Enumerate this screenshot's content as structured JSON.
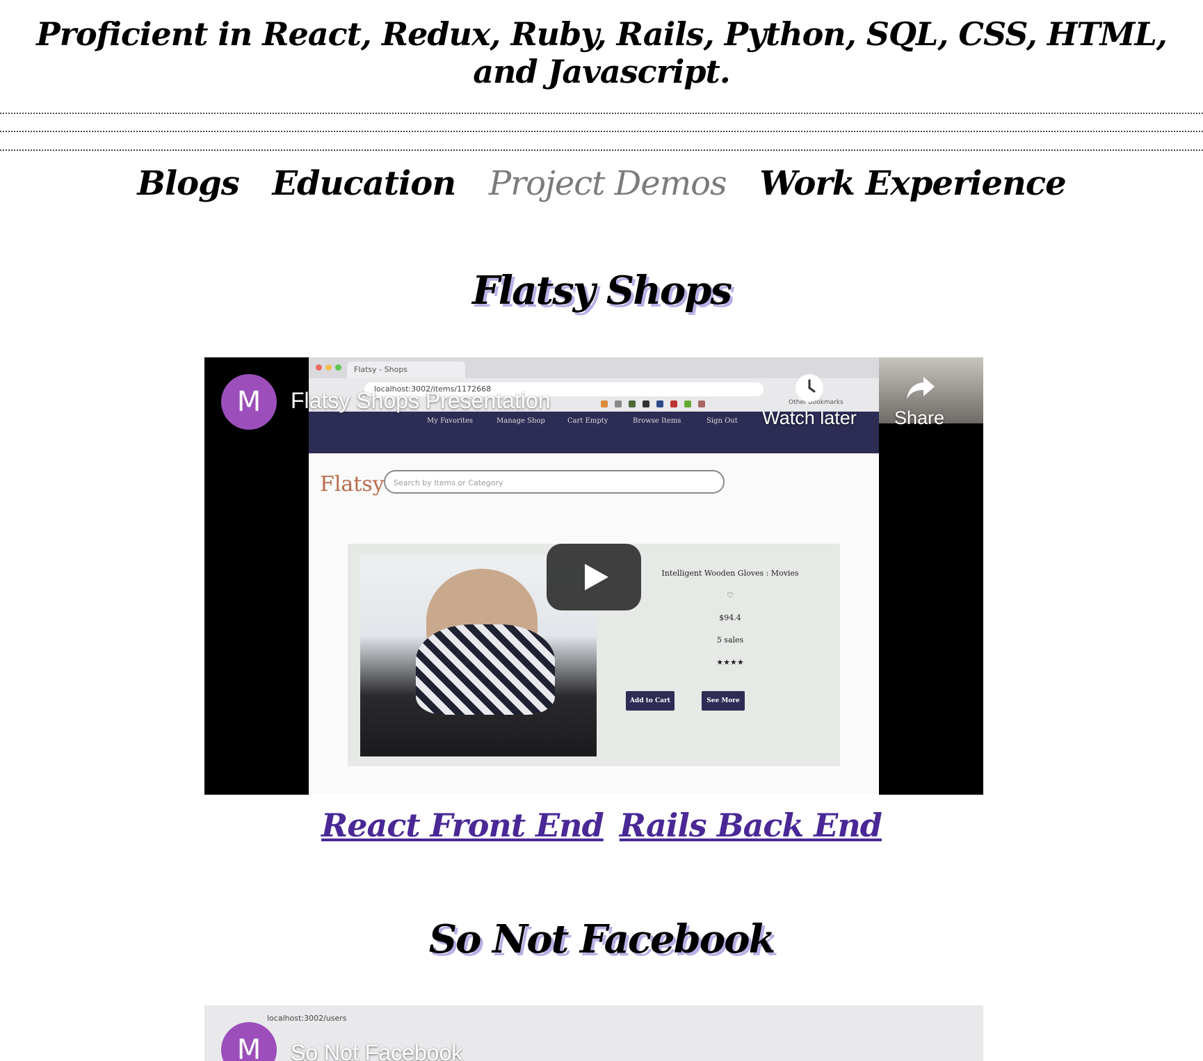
{
  "header": {
    "proficient": "Proficient in React, Redux, Ruby, Rails, Python, SQL, CSS, HTML, and Javascript."
  },
  "nav": {
    "items": [
      {
        "label": "Blogs",
        "active": false
      },
      {
        "label": "Education",
        "active": false
      },
      {
        "label": "Project Demos",
        "active": true
      },
      {
        "label": "Work Experience",
        "active": false
      }
    ]
  },
  "projects": [
    {
      "title": "Flatsy Shops",
      "video": {
        "channel_initial": "M",
        "title": "Flatsy Shops Presentation",
        "watch_later": "Watch later",
        "share": "Share",
        "url": "localhost:3002/items/1172668",
        "tab": "Flatsy - Shops",
        "other_bookmarks": "Other Bookmarks",
        "site_nav": [
          "My Favorites",
          "Manage Shop",
          "Cart Empty",
          "Browse Items",
          "Sign Out"
        ],
        "site_logo": "Flatsy",
        "site_search_placeholder": "Search by Items or Category",
        "item_name": "Intelligent Wooden Gloves : Movies",
        "item_heart": "♡",
        "item_price": "$94.4",
        "item_sales": "5 sales",
        "item_stars": "★★★★",
        "add_to_cart": "Add to Cart",
        "see_more": "See More"
      },
      "links": [
        "React Front End",
        "Rails Back End"
      ]
    },
    {
      "title": "So Not Facebook",
      "video": {
        "channel_initial": "M",
        "title": "So Not Facebook",
        "url": "localhost:3002/users"
      }
    }
  ],
  "colors": {
    "link": "#4a2896",
    "active_nav": "#7b7b7b",
    "title_shadow": "#b9b0e6",
    "avatar": "#9c4fba",
    "site_bar": "#2d2c55"
  }
}
